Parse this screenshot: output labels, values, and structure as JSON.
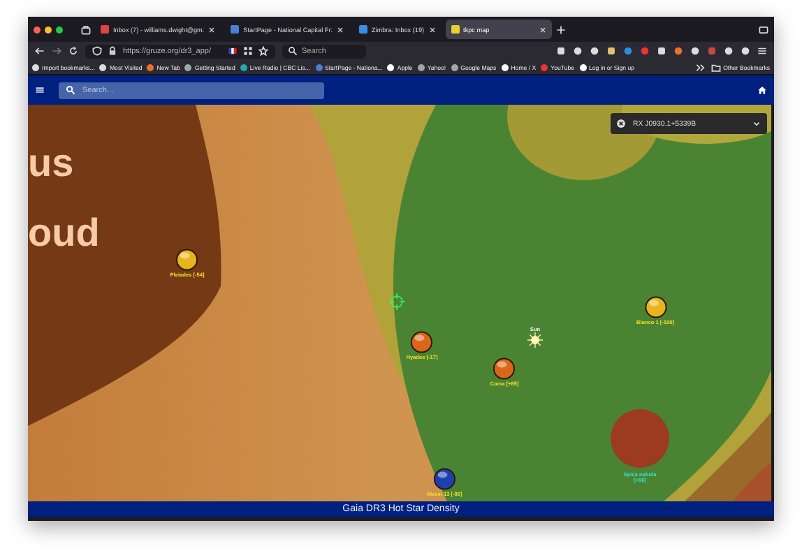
{
  "browser": {
    "tabs": [
      {
        "label": "Inbox (7) - williams.dwight@gm:",
        "selected": false
      },
      {
        "label": "StartPage - National Capital Fr:",
        "selected": false
      },
      {
        "label": "Zimbra: Inbox (19)",
        "selected": false
      },
      {
        "label": "tkpc map",
        "selected": true
      }
    ],
    "url": "https://gruze.org/dr3_app/",
    "search": {
      "placeholder": "Search"
    },
    "bookmarks": [
      "Import bookmarks...",
      "Most Visited",
      "New Tab",
      "Getting Started",
      "Live Radio | CBC Lis...",
      "StartPage - Nationa...",
      "Apple",
      "Yahoo!",
      "Google Maps",
      "Home / X",
      "YouTube",
      "Log in or Sign up"
    ],
    "other_bookmarks": "Other Bookmarks"
  },
  "app": {
    "search": {
      "placeholder": "Search..."
    },
    "map": {
      "region_labels": [
        "us",
        "oud"
      ],
      "object_select": "RX J0930.1+5339B",
      "markers": [
        {
          "label": "Pleiades [-54]",
          "kind": "sphere",
          "color": "#e8b41c"
        },
        {
          "label": "Hyades [-17]",
          "kind": "sphere",
          "color": "#d9661a"
        },
        {
          "label": "Coma [+85]",
          "kind": "sphere",
          "color": "#d9661a"
        },
        {
          "label": "Blanco 1 [-100]",
          "kind": "sphere",
          "color": "#e8b41c"
        },
        {
          "label": "Alessi 13 [-86]",
          "kind": "sphere",
          "color": "#1d3fb0"
        },
        {
          "label": "Sun",
          "kind": "sun",
          "color": "#fff6b0"
        },
        {
          "label": "Spica nebula [+56]",
          "kind": "nebula",
          "color": "#9c3a22"
        }
      ]
    },
    "footer": "Gaia DR3 Hot Star Density"
  }
}
